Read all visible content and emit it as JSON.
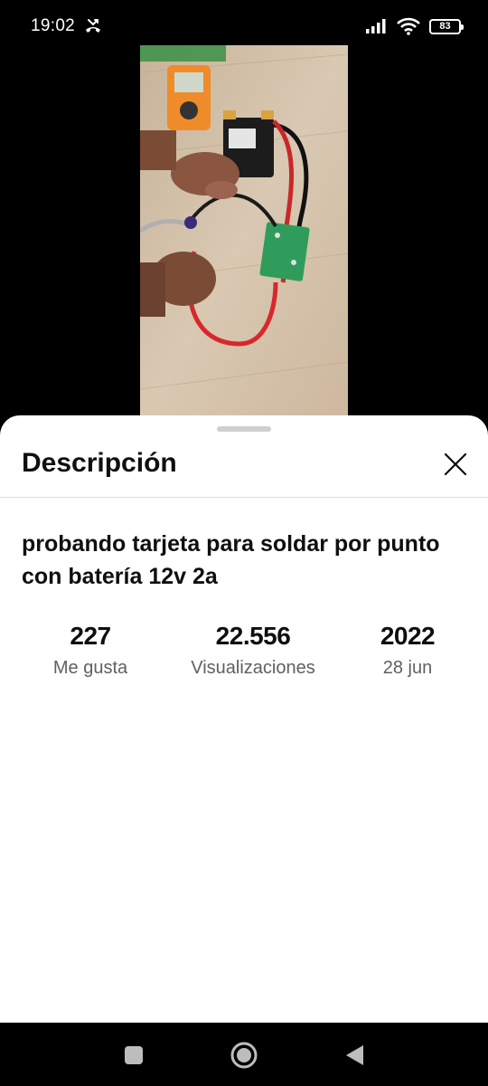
{
  "status_bar": {
    "time": "19:02",
    "battery_level": "83",
    "icons": [
      "missed-call-icon",
      "signal-icon",
      "wifi-icon",
      "battery-icon"
    ]
  },
  "video": {
    "description": "thumbnail-photo"
  },
  "sheet": {
    "title": "Descripción",
    "close_icon": "close-icon"
  },
  "video_info": {
    "title": "probando tarjeta para soldar por punto con batería 12v 2a",
    "likes_value": "227",
    "likes_label": "Me gusta",
    "views_value": "22.556",
    "views_label": "Visualizaciones",
    "year_value": "2022",
    "date_label": "28 jun"
  },
  "nav_bar": {
    "buttons": [
      "recents-button",
      "home-button",
      "back-button"
    ]
  },
  "colors": {
    "sheet_background": "#ffffff",
    "primary_text": "#0f0f0f",
    "secondary_text": "#606060",
    "divider": "#dcdcdc",
    "bars": "#000000"
  }
}
